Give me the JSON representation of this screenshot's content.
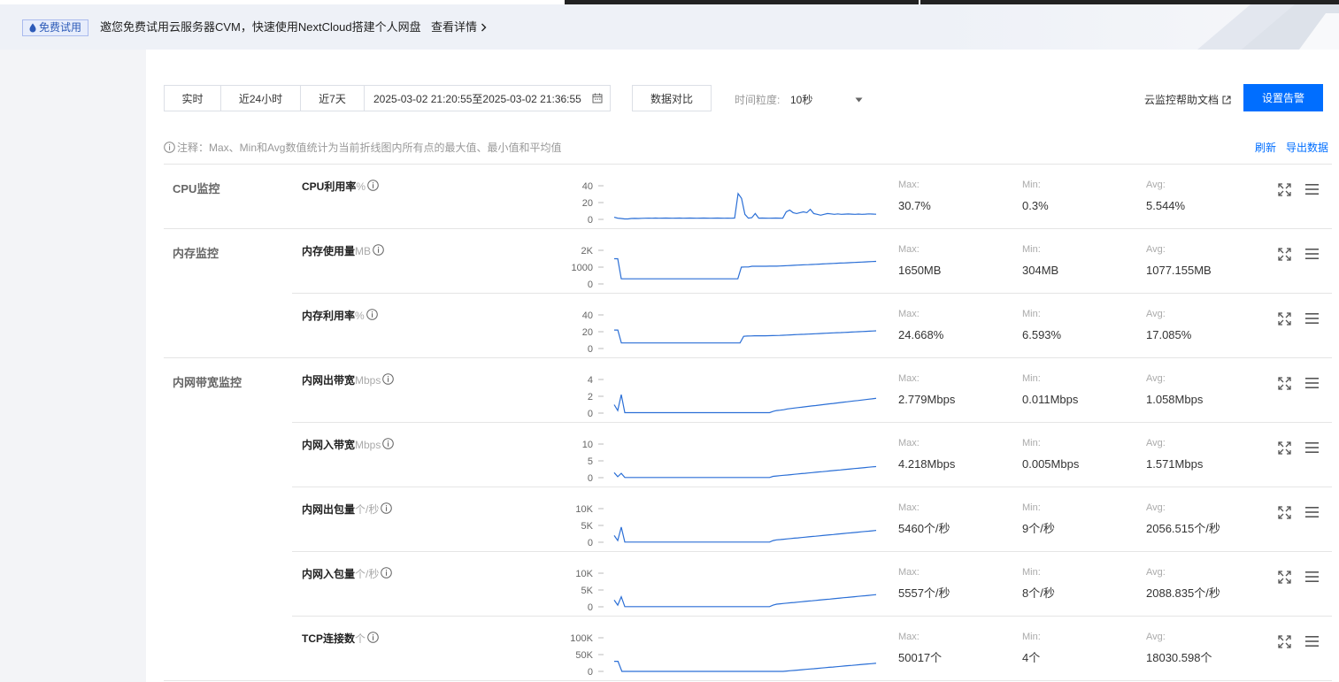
{
  "banner": {
    "badge": "免费试用",
    "text": "邀您免费试用云服务器CVM，快速使用NextCloud搭建个人网盘",
    "link": "查看详情"
  },
  "toolbar": {
    "tabs": [
      "实时",
      "近24小时",
      "近7天"
    ],
    "date_range": "2025-03-02 21:20:55至2025-03-02 21:36:55",
    "compare": "数据对比",
    "granularity_label": "时间粒度:",
    "granularity_value": "10秒",
    "help": "云监控帮助文档",
    "alarm": "设置告警"
  },
  "note": "注释：Max、Min和Avg数值统计为当前折线图内所有点的最大值、最小值和平均值",
  "actions": {
    "refresh": "刷新",
    "export": "导出数据"
  },
  "groups": [
    "CPU监控",
    "内存监控",
    "内网带宽监控"
  ],
  "stat_labels": {
    "max": "Max:",
    "min": "Min:",
    "avg": "Avg:"
  },
  "metrics": [
    {
      "name": "CPU利用率",
      "unit": "%",
      "yticks": [
        "40",
        "20",
        "0"
      ],
      "max": "30.7%",
      "min": "0.3%",
      "avg": "5.544%"
    },
    {
      "name": "内存使用量",
      "unit": "MB",
      "yticks": [
        "2K",
        "1000",
        "0"
      ],
      "max": "1650MB",
      "min": "304MB",
      "avg": "1077.155MB"
    },
    {
      "name": "内存利用率",
      "unit": "%",
      "yticks": [
        "40",
        "20",
        "0"
      ],
      "max": "24.668%",
      "min": "6.593%",
      "avg": "17.085%"
    },
    {
      "name": "内网出带宽",
      "unit": "Mbps",
      "yticks": [
        "4",
        "2",
        "0"
      ],
      "max": "2.779Mbps",
      "min": "0.011Mbps",
      "avg": "1.058Mbps"
    },
    {
      "name": "内网入带宽",
      "unit": "Mbps",
      "yticks": [
        "10",
        "5",
        "0"
      ],
      "max": "4.218Mbps",
      "min": "0.005Mbps",
      "avg": "1.571Mbps"
    },
    {
      "name": "内网出包量",
      "unit": "个/秒",
      "yticks": [
        "10K",
        "5K",
        "0"
      ],
      "max": "5460个/秒",
      "min": "9个/秒",
      "avg": "2056.515个/秒"
    },
    {
      "name": "内网入包量",
      "unit": "个/秒",
      "yticks": [
        "10K",
        "5K",
        "0"
      ],
      "max": "5557个/秒",
      "min": "8个/秒",
      "avg": "2088.835个/秒"
    },
    {
      "name": "TCP连接数",
      "unit": "个",
      "yticks": [
        "100K",
        "50K",
        "0"
      ],
      "max": "50017个",
      "min": "4个",
      "avg": "18030.598个"
    }
  ],
  "chart_data": [
    {
      "type": "line",
      "series": [
        {
          "values": [
            2.5,
            1.5,
            1,
            0.5,
            0.5,
            1,
            1.2,
            1,
            1.3,
            1.4,
            1.5,
            1.4,
            1.6,
            1.4,
            1.5,
            1.6,
            1.5,
            1.4,
            1.5,
            1.6,
            1.4,
            1.5,
            1.6,
            1.5,
            1.4,
            1.5,
            1.6,
            1.5,
            1.4,
            1.5,
            1.6,
            1.5,
            1.4,
            1.5,
            1.4,
            1.6,
            30.7,
            25,
            6,
            1.5,
            2,
            7,
            1.5,
            1.6,
            1.5,
            1.4,
            1.5,
            1.6,
            1.5,
            1.4,
            9,
            11,
            8,
            7,
            8,
            9,
            8,
            12,
            7,
            6,
            5,
            6,
            7,
            6.5,
            6,
            6.5,
            6,
            6.2,
            6.4,
            6.2,
            6,
            6.3,
            6,
            6.2,
            6.5,
            6.3,
            6.1,
            6.4,
            6.2,
            6.8,
            6.5,
            6.9,
            6.6,
            7,
            7.2,
            7.4,
            7.1,
            7.8,
            7.6,
            8,
            8.4,
            8.2,
            8.6,
            9,
            8.5,
            9.2,
            9.6,
            9.4,
            9.8,
            9.2,
            9.6,
            10,
            9.4,
            10.2,
            10.4,
            8,
            7.6,
            7.4,
            7,
            6.8,
            7,
            6.5,
            6.8,
            6.4,
            7,
            6.2,
            6
          ]
        }
      ],
      "ylim": [
        0,
        45
      ]
    },
    {
      "type": "line",
      "series": [
        {
          "values": [
            1500,
            1500,
            304,
            304,
            304,
            304,
            304,
            304,
            304,
            304,
            304,
            304,
            304,
            304,
            304,
            304,
            304,
            304,
            304,
            304,
            304,
            304,
            304,
            304,
            304,
            304,
            304,
            304,
            304,
            304,
            304,
            304,
            304,
            304,
            304,
            304,
            1000,
            1010,
            1010,
            1050,
            1050,
            1050,
            1050,
            1050,
            1060,
            1060,
            1060,
            1070,
            1080,
            1090,
            1100,
            1110,
            1120,
            1130,
            1140,
            1150,
            1160,
            1170,
            1180,
            1190,
            1200,
            1210,
            1220,
            1230,
            1240,
            1250,
            1260,
            1270,
            1280,
            1290,
            1300,
            1310,
            1320,
            1330,
            1340,
            1350,
            1360,
            1370,
            1380,
            1390,
            1400,
            1410,
            1420,
            1430,
            1440,
            1450,
            1460,
            1470,
            1480,
            1490,
            1500,
            1510,
            1520,
            1530,
            1540,
            1550,
            1560,
            1570,
            1580,
            1590,
            1600,
            1610,
            1620,
            1630,
            1640,
            1650,
            1650,
            1650,
            1650,
            1650,
            1650,
            1650,
            1650,
            1650
          ]
        }
      ],
      "ylim": [
        0,
        2200
      ]
    },
    {
      "type": "line",
      "series": [
        {
          "values": [
            22,
            22,
            6.6,
            6.6,
            6.6,
            6.6,
            6.6,
            6.6,
            6.6,
            6.6,
            6.6,
            6.6,
            6.6,
            6.6,
            6.6,
            6.6,
            6.6,
            6.6,
            6.6,
            6.6,
            6.6,
            6.6,
            6.6,
            6.6,
            6.6,
            6.6,
            6.6,
            6.6,
            6.6,
            6.6,
            6.6,
            6.6,
            6.6,
            6.6,
            6.6,
            6.6,
            14.5,
            14.8,
            15,
            15.2,
            15.2,
            15.2,
            15.2,
            15.3,
            15.4,
            15.5,
            15.6,
            15.8,
            16,
            16.2,
            16.4,
            16.6,
            16.8,
            17,
            17.2,
            17.4,
            17.6,
            17.8,
            18,
            18.2,
            18.4,
            18.6,
            18.8,
            19,
            19.2,
            19.4,
            19.6,
            19.8,
            20,
            20.2,
            20.4,
            20.6,
            20.8,
            21,
            21.2,
            21.4,
            21.6,
            21.8,
            22,
            22.2,
            22.4,
            22.6,
            22.8,
            23,
            23.2,
            23.4,
            23.6,
            23.8,
            24,
            24.2,
            24.4,
            24.5,
            24.6,
            24.668,
            24.668,
            24.668,
            24.668,
            24.668,
            24.668,
            24.668,
            24.668,
            24.668,
            24.668,
            24.668,
            24.668,
            24.668,
            24.668,
            24.668,
            24.668,
            24.668,
            24.668,
            24.668
          ]
        }
      ],
      "ylim": [
        0,
        45
      ]
    },
    {
      "type": "line",
      "series": [
        {
          "values": [
            1,
            0.3,
            2.2,
            0.05,
            0.05,
            0.05,
            0.05,
            0.05,
            0.05,
            0.05,
            0.05,
            0.05,
            0.05,
            0.05,
            0.05,
            0.05,
            0.05,
            0.05,
            0.05,
            0.05,
            0.05,
            0.05,
            0.05,
            0.05,
            0.05,
            0.05,
            0.05,
            0.05,
            0.05,
            0.05,
            0.05,
            0.05,
            0.05,
            0.05,
            0.05,
            0.05,
            0.05,
            0.05,
            0.05,
            0.05,
            0.05,
            0.05,
            0.05,
            0.05,
            0.05,
            0.2,
            0.3,
            0.35,
            0.4,
            0.5,
            0.55,
            0.6,
            0.65,
            0.7,
            0.75,
            0.8,
            0.85,
            0.9,
            0.95,
            1,
            1.05,
            1.1,
            1.15,
            1.2,
            1.25,
            1.3,
            1.35,
            1.4,
            1.45,
            1.5,
            1.55,
            1.6,
            1.65,
            1.7,
            1.75,
            1.8,
            1.85,
            1.9,
            1.95,
            2,
            2.05,
            2.1,
            2.15,
            2.2,
            2.25,
            2.3,
            2.35,
            2.4,
            2.5,
            2.6,
            2.65,
            2.7,
            2.75,
            2.8,
            2.85,
            2.9,
            2.6,
            2.8,
            2.85,
            2.95,
            3,
            3.05,
            3.1,
            3.15,
            3.2,
            3.3,
            3.2,
            3.1,
            3.05,
            3,
            3,
            3,
            3,
            3
          ]
        }
      ],
      "ylim": [
        0,
        4.5
      ]
    },
    {
      "type": "line",
      "series": [
        {
          "values": [
            1.5,
            0.3,
            1.3,
            0.05,
            0.05,
            0.05,
            0.05,
            0.05,
            0.05,
            0.05,
            0.05,
            0.05,
            0.05,
            0.05,
            0.05,
            0.05,
            0.05,
            0.05,
            0.05,
            0.05,
            0.05,
            0.05,
            0.05,
            0.05,
            0.05,
            0.05,
            0.05,
            0.05,
            0.05,
            0.05,
            0.05,
            0.05,
            0.05,
            0.05,
            0.05,
            0.05,
            0.05,
            0.05,
            0.05,
            0.05,
            0.05,
            0.05,
            0.05,
            0.05,
            0.05,
            0.4,
            0.5,
            0.6,
            0.7,
            0.8,
            0.9,
            1,
            1.1,
            1.2,
            1.3,
            1.4,
            1.5,
            1.6,
            1.7,
            1.8,
            1.9,
            2,
            2.1,
            2.2,
            2.3,
            2.4,
            2.5,
            2.6,
            2.7,
            2.8,
            2.9,
            3,
            3.1,
            3.2,
            3.3,
            3.4,
            3.5,
            3.6,
            3.7,
            3.8,
            3.9,
            4,
            4.1,
            4.2,
            4.3,
            4.4,
            4.5,
            4.6,
            4.7,
            4.8,
            4.9,
            5,
            5.1,
            5.2,
            5.3,
            5.4,
            5.1,
            5.3,
            5.4,
            5.5,
            5.6,
            5.7,
            5.8,
            5.9,
            6,
            6.1,
            6.2,
            6,
            5.9,
            5.8,
            5.8,
            5.8,
            5.8,
            5.8
          ]
        }
      ],
      "ylim": [
        0,
        11
      ]
    },
    {
      "type": "line",
      "series": [
        {
          "values": [
            2000,
            500,
            4500,
            50,
            50,
            50,
            50,
            50,
            50,
            50,
            50,
            50,
            50,
            50,
            50,
            50,
            50,
            50,
            50,
            50,
            50,
            50,
            50,
            50,
            50,
            50,
            50,
            50,
            50,
            50,
            50,
            50,
            50,
            50,
            50,
            50,
            50,
            50,
            50,
            50,
            50,
            50,
            50,
            50,
            50,
            500,
            700,
            800,
            900,
            1000,
            1100,
            1200,
            1300,
            1400,
            1500,
            1600,
            1700,
            1800,
            1900,
            2000,
            2100,
            2200,
            2300,
            2400,
            2500,
            2600,
            2700,
            2800,
            2900,
            3000,
            3100,
            3200,
            3300,
            3400,
            3500,
            3600,
            3700,
            3800,
            3900,
            4000,
            4100,
            4200,
            4300,
            4400,
            4500,
            4600,
            4700,
            4800,
            4900,
            5000,
            5100,
            5200,
            5300,
            5400,
            5460,
            5000,
            5200,
            5250,
            5300,
            5350,
            5400,
            5450,
            5500,
            5550,
            5600,
            5650,
            5700,
            5600,
            5500,
            5500,
            5500,
            5500,
            5500,
            5500
          ]
        }
      ],
      "ylim": [
        0,
        11000
      ]
    },
    {
      "type": "line",
      "series": [
        {
          "values": [
            2000,
            500,
            3000,
            50,
            50,
            50,
            50,
            50,
            50,
            50,
            50,
            50,
            50,
            50,
            50,
            50,
            50,
            50,
            50,
            50,
            50,
            50,
            50,
            50,
            50,
            50,
            50,
            50,
            50,
            50,
            50,
            50,
            50,
            50,
            50,
            50,
            50,
            50,
            50,
            50,
            50,
            50,
            50,
            50,
            50,
            500,
            800,
            900,
            1000,
            1100,
            1200,
            1300,
            1400,
            1500,
            1600,
            1700,
            1800,
            1900,
            2000,
            2100,
            2200,
            2300,
            2400,
            2500,
            2600,
            2700,
            2800,
            2900,
            3000,
            3100,
            3200,
            3300,
            3400,
            3500,
            3600,
            3700,
            3800,
            3900,
            4000,
            4100,
            4200,
            4300,
            4400,
            4500,
            4600,
            4700,
            4800,
            4900,
            5000,
            5100,
            5200,
            5300,
            5400,
            5500,
            5557,
            5000,
            5200,
            5300,
            5350,
            5400,
            5450,
            5500,
            5550,
            5600,
            5650,
            5700,
            5750,
            5600,
            5500,
            5500,
            5500,
            5500,
            5500,
            5500
          ]
        }
      ],
      "ylim": [
        0,
        11000
      ]
    },
    {
      "type": "line",
      "series": [
        {
          "values": [
            30000,
            30000,
            4,
            4,
            4,
            4,
            4,
            4,
            4,
            4,
            4,
            4,
            4,
            4,
            4,
            4,
            4,
            4,
            4,
            4,
            4,
            4,
            4,
            4,
            4,
            4,
            4,
            4,
            4,
            4,
            4,
            4,
            4,
            4,
            4,
            4,
            4,
            4,
            4,
            4,
            4,
            4,
            4,
            4,
            4,
            1000,
            2000,
            3000,
            4000,
            5000,
            6000,
            7000,
            8000,
            9000,
            10000,
            11000,
            12000,
            13000,
            14000,
            15000,
            16000,
            17000,
            18000,
            19000,
            20000,
            21000,
            22000,
            23000,
            24000,
            25000,
            26000,
            27000,
            28000,
            29000,
            30000,
            31000,
            32000,
            33000,
            34000,
            35000,
            36000,
            37000,
            38000,
            39000,
            40000,
            41000,
            42000,
            43000,
            44000,
            45000,
            46000,
            47000,
            48000,
            49000,
            50017,
            50017,
            50017,
            50017,
            50017,
            50017,
            50017,
            50017,
            50017,
            50017,
            50017
          ]
        }
      ],
      "ylim": [
        0,
        110000
      ]
    }
  ]
}
